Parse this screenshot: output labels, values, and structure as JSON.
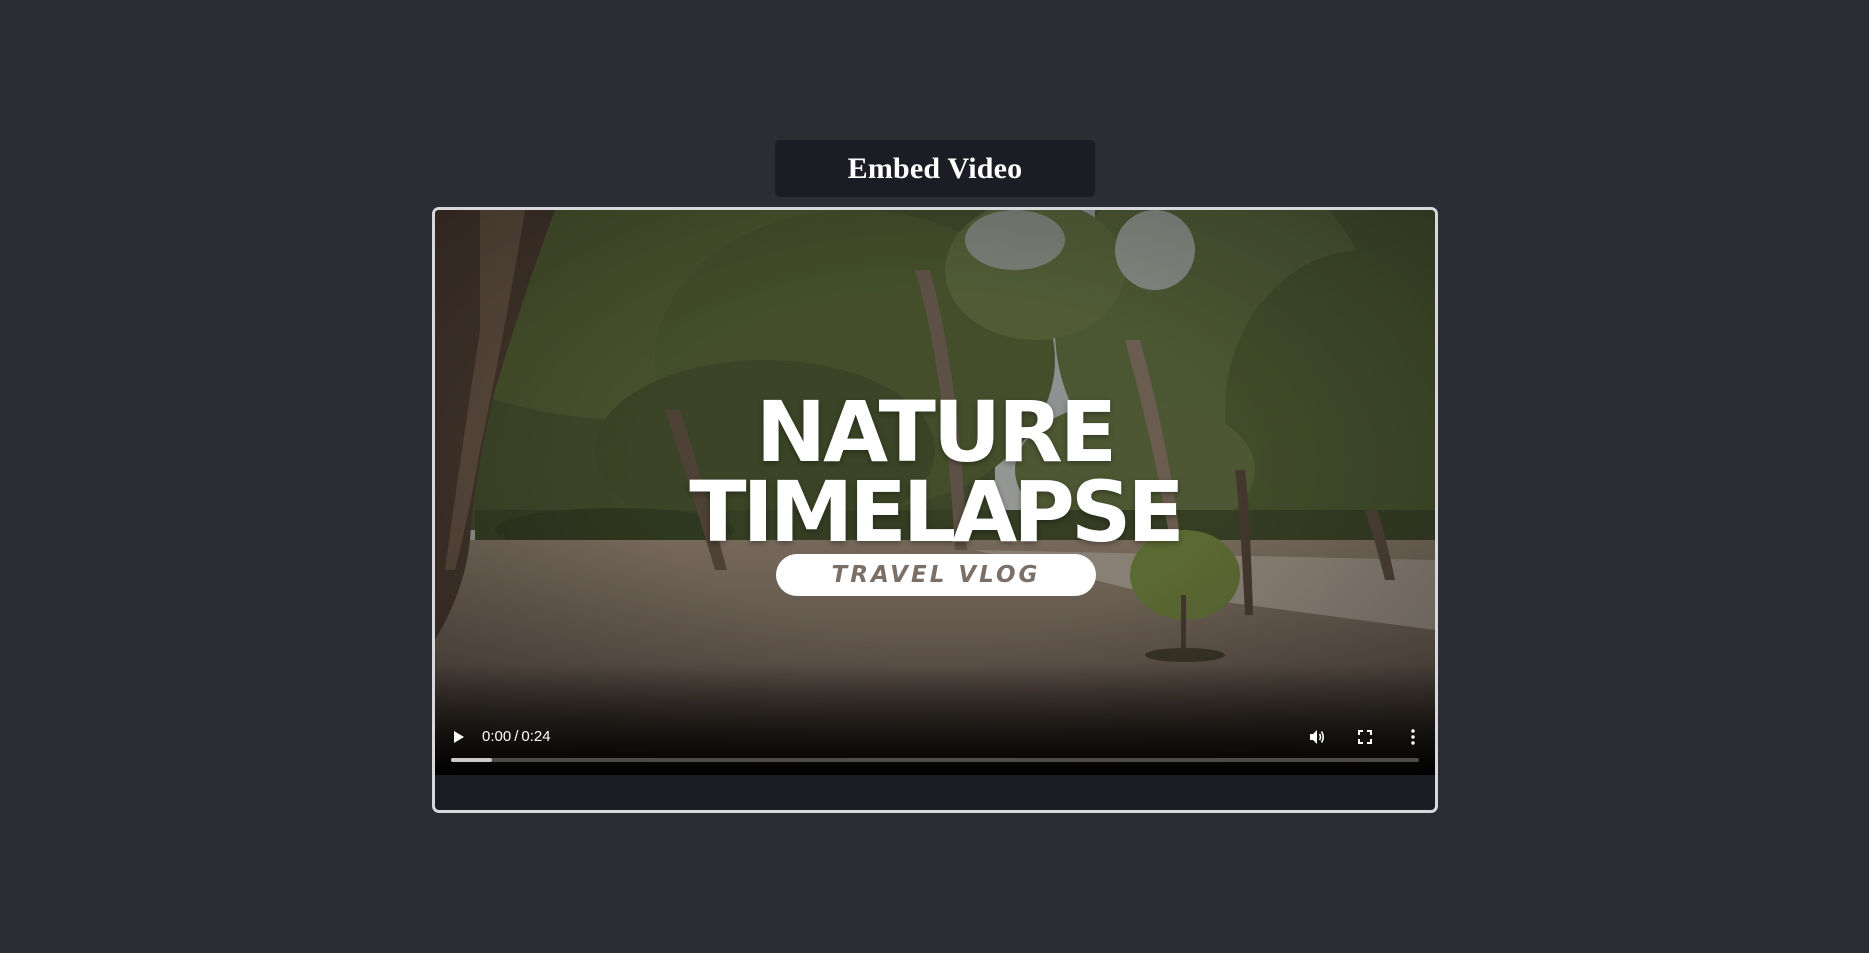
{
  "page": {
    "title": "Embed Video"
  },
  "video": {
    "overlay": {
      "line1": "NATURE",
      "line2": "TIMELAPSE",
      "pill": "TRAVEL VLOG"
    },
    "controls": {
      "current_time": "0:00",
      "separator": "/",
      "duration": "0:24",
      "buffered_fraction": 0.042
    },
    "icons": {
      "play": "play-icon",
      "volume": "volume-icon",
      "fullscreen": "fullscreen-icon",
      "more": "more-vertical-icon"
    }
  },
  "colors": {
    "page_background": "#2c2d32",
    "title_box": "#1c1c24",
    "frame_border": "#d8d8dc",
    "pill_text": "#7b7067"
  }
}
